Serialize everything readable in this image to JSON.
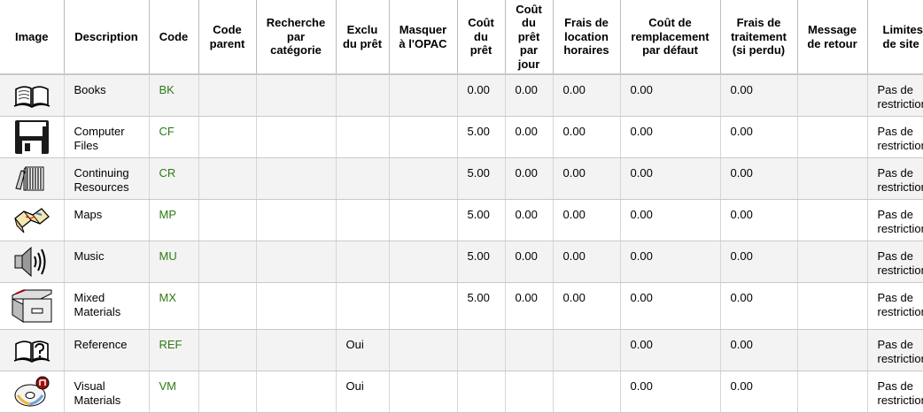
{
  "headers": {
    "image": "Image",
    "description": "Description",
    "code": "Code",
    "parent_code": "Code parent",
    "category_search": "Recherche par catégorie",
    "not_for_loan": "Exclu du prêt",
    "hide_opac": "Masquer à l'OPAC",
    "rental_charge": "Coût du prêt",
    "daily_rental": "Coût du prêt par jour",
    "hourly_rental": "Frais de location horaires",
    "default_replacement": "Coût de remplacement par défaut",
    "processing_fee": "Frais de traitement (si perdu)",
    "checkin_message": "Message de retour",
    "site_limits": "Limites de site"
  },
  "rows": [
    {
      "icon": "book-icon",
      "description": "Books",
      "code": "BK",
      "parent": "",
      "catsearch": "",
      "notforloan": "",
      "hide": "",
      "rental": "0.00",
      "daily": "0.00",
      "hourly": "0.00",
      "replacement": "0.00",
      "processing": "0.00",
      "message": "",
      "limits": "Pas de restriction"
    },
    {
      "icon": "floppy-disk-icon",
      "description": "Computer Files",
      "code": "CF",
      "parent": "",
      "catsearch": "",
      "notforloan": "",
      "hide": "",
      "rental": "5.00",
      "daily": "0.00",
      "hourly": "0.00",
      "replacement": "0.00",
      "processing": "0.00",
      "message": "",
      "limits": "Pas de restriction"
    },
    {
      "icon": "stacked-books-icon",
      "description": "Continuing Resources",
      "code": "CR",
      "parent": "",
      "catsearch": "",
      "notforloan": "",
      "hide": "",
      "rental": "5.00",
      "daily": "0.00",
      "hourly": "0.00",
      "replacement": "0.00",
      "processing": "0.00",
      "message": "",
      "limits": "Pas de restriction"
    },
    {
      "icon": "map-icon",
      "description": "Maps",
      "code": "MP",
      "parent": "",
      "catsearch": "",
      "notforloan": "",
      "hide": "",
      "rental": "5.00",
      "daily": "0.00",
      "hourly": "0.00",
      "replacement": "0.00",
      "processing": "0.00",
      "message": "",
      "limits": "Pas de restriction"
    },
    {
      "icon": "speaker-icon",
      "description": "Music",
      "code": "MU",
      "parent": "",
      "catsearch": "",
      "notforloan": "",
      "hide": "",
      "rental": "5.00",
      "daily": "0.00",
      "hourly": "0.00",
      "replacement": "0.00",
      "processing": "0.00",
      "message": "",
      "limits": "Pas de restriction"
    },
    {
      "icon": "file-box-icon",
      "description": "Mixed Materials",
      "code": "MX",
      "parent": "",
      "catsearch": "",
      "notforloan": "",
      "hide": "",
      "rental": "5.00",
      "daily": "0.00",
      "hourly": "0.00",
      "replacement": "0.00",
      "processing": "0.00",
      "message": "",
      "limits": "Pas de restriction"
    },
    {
      "icon": "reference-book-icon",
      "description": "Reference",
      "code": "REF",
      "parent": "",
      "catsearch": "",
      "notforloan": "Oui",
      "hide": "",
      "rental": "",
      "daily": "",
      "hourly": "",
      "replacement": "0.00",
      "processing": "0.00",
      "message": "",
      "limits": "Pas de restriction"
    },
    {
      "icon": "cd-disc-icon",
      "description": "Visual Materials",
      "code": "VM",
      "parent": "",
      "catsearch": "",
      "notforloan": "Oui",
      "hide": "",
      "rental": "",
      "daily": "",
      "hourly": "",
      "replacement": "0.00",
      "processing": "0.00",
      "message": "",
      "limits": "Pas de restriction"
    }
  ],
  "colors": {
    "link": "#2c7a13",
    "stripe": "#f3f3f3"
  }
}
